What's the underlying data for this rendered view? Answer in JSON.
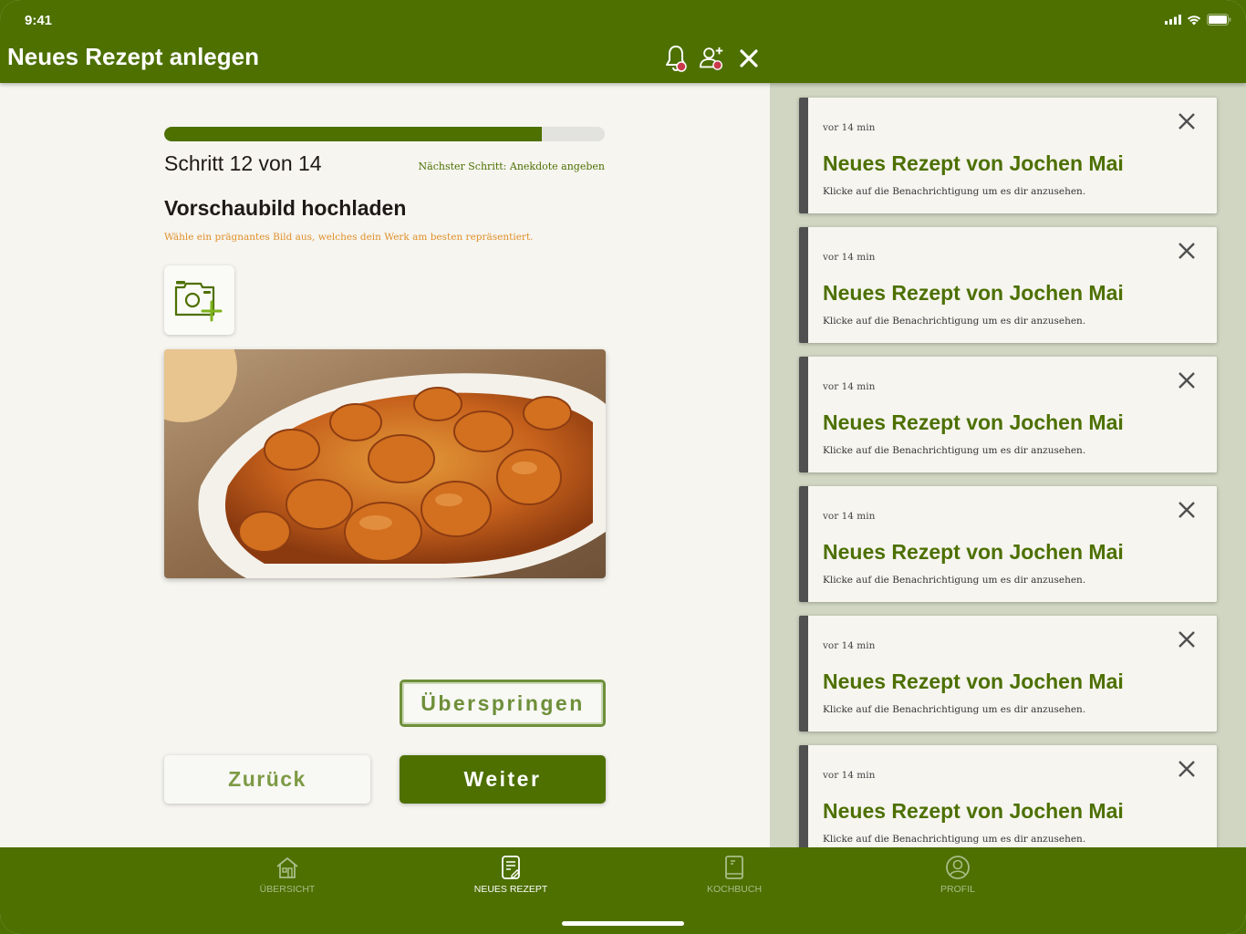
{
  "status": {
    "time": "9:41"
  },
  "header": {
    "title": "Neues Rezept anlegen",
    "actions": [
      "bell-icon",
      "add-user-icon",
      "close-icon"
    ]
  },
  "wizard": {
    "step_label": "Schritt 12 von 14",
    "progress": 0.857,
    "next_step": "Nächster Schritt: Anekdote angeben",
    "section_title": "Vorschaubild hochladen",
    "section_subtitle": "Wähle ein prägnantes Bild aus, welches dein Werk am besten repräsentiert.",
    "upload_icon": "add-photo-icon",
    "preview_image": "currywurst-photo",
    "skip_label": "Überspringen",
    "back_label": "Zurück",
    "next_label": "Weiter"
  },
  "notifications": [
    {
      "time": "vor 14 min",
      "title": "Neues Rezept von Jochen Mai",
      "text": "Klicke auf die Benachrichtigung um es dir anzusehen."
    },
    {
      "time": "vor 14 min",
      "title": "Neues Rezept von Jochen Mai",
      "text": "Klicke auf die Benachrichtigung um es dir anzusehen."
    },
    {
      "time": "vor 14 min",
      "title": "Neues Rezept von Jochen Mai",
      "text": "Klicke auf die Benachrichtigung um es dir anzusehen."
    },
    {
      "time": "vor 14 min",
      "title": "Neues Rezept von Jochen Mai",
      "text": "Klicke auf die Benachrichtigung um es dir anzusehen."
    },
    {
      "time": "vor 14 min",
      "title": "Neues Rezept von Jochen Mai",
      "text": "Klicke auf die Benachrichtigung um es dir anzusehen."
    },
    {
      "time": "vor 14 min",
      "title": "Neues Rezept von Jochen Mai",
      "text": "Klicke auf die Benachrichtigung um es dir anzusehen."
    }
  ],
  "nav": {
    "items": [
      {
        "label": "ÜBERSICHT",
        "icon": "home-icon",
        "active": false
      },
      {
        "label": "NEUES REZEPT",
        "icon": "new-recipe-icon",
        "active": true
      },
      {
        "label": "KOCHBUCH",
        "icon": "cookbook-icon",
        "active": false
      },
      {
        "label": "PROFIL",
        "icon": "profile-icon",
        "active": false
      }
    ]
  },
  "colors": {
    "brand_green": "#4d7000",
    "accent_orange": "#e0902a",
    "notification_bg": "#d0d6c2"
  }
}
